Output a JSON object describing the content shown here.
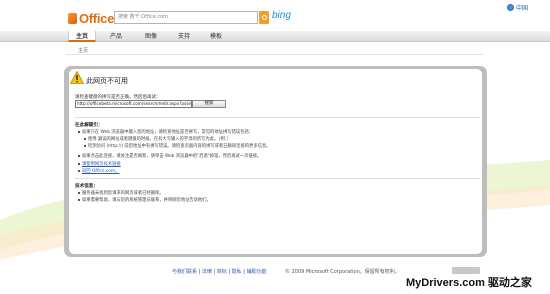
{
  "header": {
    "logo_text": "Office",
    "search_placeholder": "搜索 数千 Office.com",
    "bing_label": "bing",
    "locale_label": "中国"
  },
  "nav": {
    "items": [
      {
        "label": "主页",
        "active": true
      },
      {
        "label": "产品",
        "active": false
      },
      {
        "label": "图像",
        "active": false
      },
      {
        "label": "支持",
        "active": false
      },
      {
        "label": "模板",
        "active": false
      }
    ],
    "breadcrumb": "主页"
  },
  "error": {
    "title": "此网页不可用",
    "prompt": "请检查键盘的拼写是否正确，然后后再试：",
    "url_value": "http://officebeta.microsoft.com/search/redir.aspx?assetid=md",
    "go_label": "搜索"
  },
  "tips": {
    "title": "在此解疑引：",
    "lines": [
      "如果只在 Web 浏览器中输入您的地址，请检查地址是否拼写，常见的地址拼写错误包括：",
      "使用 漏误的网址或者键盘的时候，在有大写输入的字母的所写为此。（例：）",
      "检测访问 (http://) 前后地址中有拼写错误。请检查页面内容的拼写或者已删除连接的更多信息。",
      "如果点击此连接，请关注是否刷新，请单击 Web 浏览器中的\"后退\"按钮，然后再试一次链接。",
      "请使用网页技术链接",
      "返回 Office.com。"
    ]
  },
  "tech": {
    "title": "技术信息：",
    "lines": [
      "服务器未找到您请求的网页或者已经删除。",
      "如果需要帮助，请与您的系统管理员联系，并将网页地址告诉他们。"
    ]
  },
  "footer": {
    "links": [
      "与我们联系",
      "法律",
      "商标",
      "隐私",
      "辅助功能"
    ],
    "copyright": "© 2009 Microsoft Corporation，保留所有权利。"
  },
  "watermark": "MyDrivers.com 驱动之家",
  "colors": {
    "accent": "#e36c0a",
    "link": "#2a5db0",
    "panel_border": "#bdbdbd",
    "bing": "#1b8fd6"
  }
}
